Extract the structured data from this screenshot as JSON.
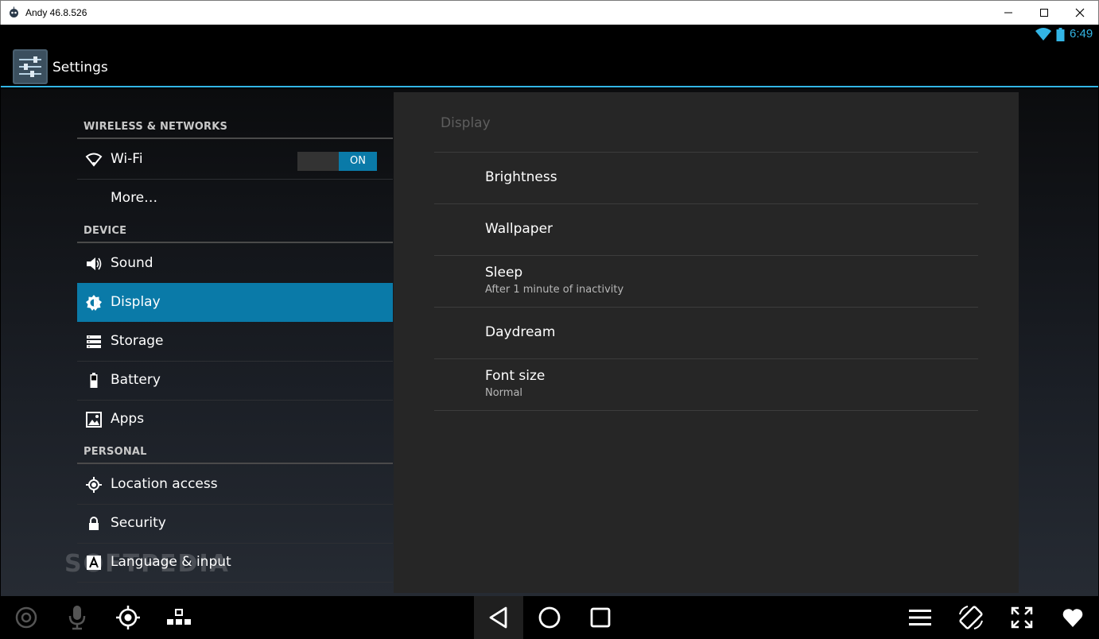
{
  "window": {
    "title": "Andy 46.8.526"
  },
  "status": {
    "time": "6:49"
  },
  "actionbar": {
    "title": "Settings"
  },
  "sidebar": {
    "sections": [
      {
        "header": "WIRELESS & NETWORKS"
      },
      {
        "header": "DEVICE"
      },
      {
        "header": "PERSONAL"
      }
    ],
    "items": [
      {
        "label": "Wi-Fi",
        "icon": "wifi-icon"
      },
      {
        "label": "More…"
      },
      {
        "label": "Sound",
        "icon": "speaker-icon"
      },
      {
        "label": "Display",
        "icon": "brightness-icon",
        "selected": true
      },
      {
        "label": "Storage",
        "icon": "storage-icon"
      },
      {
        "label": "Battery",
        "icon": "battery-icon"
      },
      {
        "label": "Apps",
        "icon": "apps-icon"
      },
      {
        "label": "Location access",
        "icon": "location-icon"
      },
      {
        "label": "Security",
        "icon": "lock-icon"
      },
      {
        "label": "Language & input",
        "icon": "language-icon"
      }
    ],
    "wifi_toggle": "ON"
  },
  "display_pane": {
    "title": "Display",
    "prefs": [
      {
        "title": "Brightness",
        "summary": ""
      },
      {
        "title": "Wallpaper",
        "summary": ""
      },
      {
        "title": "Sleep",
        "summary": "After 1 minute of inactivity"
      },
      {
        "title": "Daydream",
        "summary": ""
      },
      {
        "title": "Font size",
        "summary": "Normal"
      }
    ]
  },
  "watermark": "SOFTPEDIA",
  "colors": {
    "accent": "#33b5e5",
    "selected": "#0a7aa8"
  }
}
